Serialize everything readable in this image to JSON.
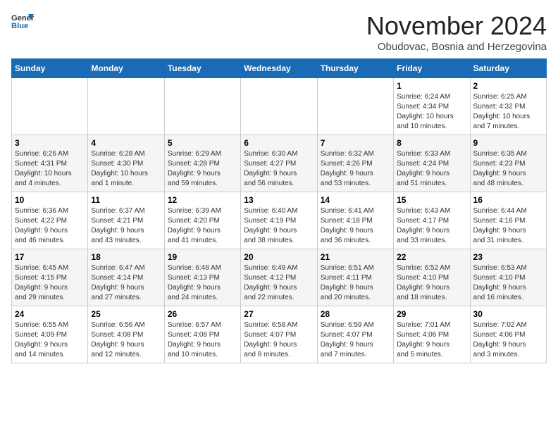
{
  "logo": {
    "text_general": "General",
    "text_blue": "Blue"
  },
  "header": {
    "month_year": "November 2024",
    "location": "Obudovac, Bosnia and Herzegovina"
  },
  "weekdays": [
    "Sunday",
    "Monday",
    "Tuesday",
    "Wednesday",
    "Thursday",
    "Friday",
    "Saturday"
  ],
  "weeks": [
    [
      {
        "day": "",
        "info": ""
      },
      {
        "day": "",
        "info": ""
      },
      {
        "day": "",
        "info": ""
      },
      {
        "day": "",
        "info": ""
      },
      {
        "day": "",
        "info": ""
      },
      {
        "day": "1",
        "info": "Sunrise: 6:24 AM\nSunset: 4:34 PM\nDaylight: 10 hours\nand 10 minutes."
      },
      {
        "day": "2",
        "info": "Sunrise: 6:25 AM\nSunset: 4:32 PM\nDaylight: 10 hours\nand 7 minutes."
      }
    ],
    [
      {
        "day": "3",
        "info": "Sunrise: 6:26 AM\nSunset: 4:31 PM\nDaylight: 10 hours\nand 4 minutes."
      },
      {
        "day": "4",
        "info": "Sunrise: 6:28 AM\nSunset: 4:30 PM\nDaylight: 10 hours\nand 1 minute."
      },
      {
        "day": "5",
        "info": "Sunrise: 6:29 AM\nSunset: 4:28 PM\nDaylight: 9 hours\nand 59 minutes."
      },
      {
        "day": "6",
        "info": "Sunrise: 6:30 AM\nSunset: 4:27 PM\nDaylight: 9 hours\nand 56 minutes."
      },
      {
        "day": "7",
        "info": "Sunrise: 6:32 AM\nSunset: 4:26 PM\nDaylight: 9 hours\nand 53 minutes."
      },
      {
        "day": "8",
        "info": "Sunrise: 6:33 AM\nSunset: 4:24 PM\nDaylight: 9 hours\nand 51 minutes."
      },
      {
        "day": "9",
        "info": "Sunrise: 6:35 AM\nSunset: 4:23 PM\nDaylight: 9 hours\nand 48 minutes."
      }
    ],
    [
      {
        "day": "10",
        "info": "Sunrise: 6:36 AM\nSunset: 4:22 PM\nDaylight: 9 hours\nand 46 minutes."
      },
      {
        "day": "11",
        "info": "Sunrise: 6:37 AM\nSunset: 4:21 PM\nDaylight: 9 hours\nand 43 minutes."
      },
      {
        "day": "12",
        "info": "Sunrise: 6:39 AM\nSunset: 4:20 PM\nDaylight: 9 hours\nand 41 minutes."
      },
      {
        "day": "13",
        "info": "Sunrise: 6:40 AM\nSunset: 4:19 PM\nDaylight: 9 hours\nand 38 minutes."
      },
      {
        "day": "14",
        "info": "Sunrise: 6:41 AM\nSunset: 4:18 PM\nDaylight: 9 hours\nand 36 minutes."
      },
      {
        "day": "15",
        "info": "Sunrise: 6:43 AM\nSunset: 4:17 PM\nDaylight: 9 hours\nand 33 minutes."
      },
      {
        "day": "16",
        "info": "Sunrise: 6:44 AM\nSunset: 4:16 PM\nDaylight: 9 hours\nand 31 minutes."
      }
    ],
    [
      {
        "day": "17",
        "info": "Sunrise: 6:45 AM\nSunset: 4:15 PM\nDaylight: 9 hours\nand 29 minutes."
      },
      {
        "day": "18",
        "info": "Sunrise: 6:47 AM\nSunset: 4:14 PM\nDaylight: 9 hours\nand 27 minutes."
      },
      {
        "day": "19",
        "info": "Sunrise: 6:48 AM\nSunset: 4:13 PM\nDaylight: 9 hours\nand 24 minutes."
      },
      {
        "day": "20",
        "info": "Sunrise: 6:49 AM\nSunset: 4:12 PM\nDaylight: 9 hours\nand 22 minutes."
      },
      {
        "day": "21",
        "info": "Sunrise: 6:51 AM\nSunset: 4:11 PM\nDaylight: 9 hours\nand 20 minutes."
      },
      {
        "day": "22",
        "info": "Sunrise: 6:52 AM\nSunset: 4:10 PM\nDaylight: 9 hours\nand 18 minutes."
      },
      {
        "day": "23",
        "info": "Sunrise: 6:53 AM\nSunset: 4:10 PM\nDaylight: 9 hours\nand 16 minutes."
      }
    ],
    [
      {
        "day": "24",
        "info": "Sunrise: 6:55 AM\nSunset: 4:09 PM\nDaylight: 9 hours\nand 14 minutes."
      },
      {
        "day": "25",
        "info": "Sunrise: 6:56 AM\nSunset: 4:08 PM\nDaylight: 9 hours\nand 12 minutes."
      },
      {
        "day": "26",
        "info": "Sunrise: 6:57 AM\nSunset: 4:08 PM\nDaylight: 9 hours\nand 10 minutes."
      },
      {
        "day": "27",
        "info": "Sunrise: 6:58 AM\nSunset: 4:07 PM\nDaylight: 9 hours\nand 8 minutes."
      },
      {
        "day": "28",
        "info": "Sunrise: 6:59 AM\nSunset: 4:07 PM\nDaylight: 9 hours\nand 7 minutes."
      },
      {
        "day": "29",
        "info": "Sunrise: 7:01 AM\nSunset: 4:06 PM\nDaylight: 9 hours\nand 5 minutes."
      },
      {
        "day": "30",
        "info": "Sunrise: 7:02 AM\nSunset: 4:06 PM\nDaylight: 9 hours\nand 3 minutes."
      }
    ]
  ]
}
